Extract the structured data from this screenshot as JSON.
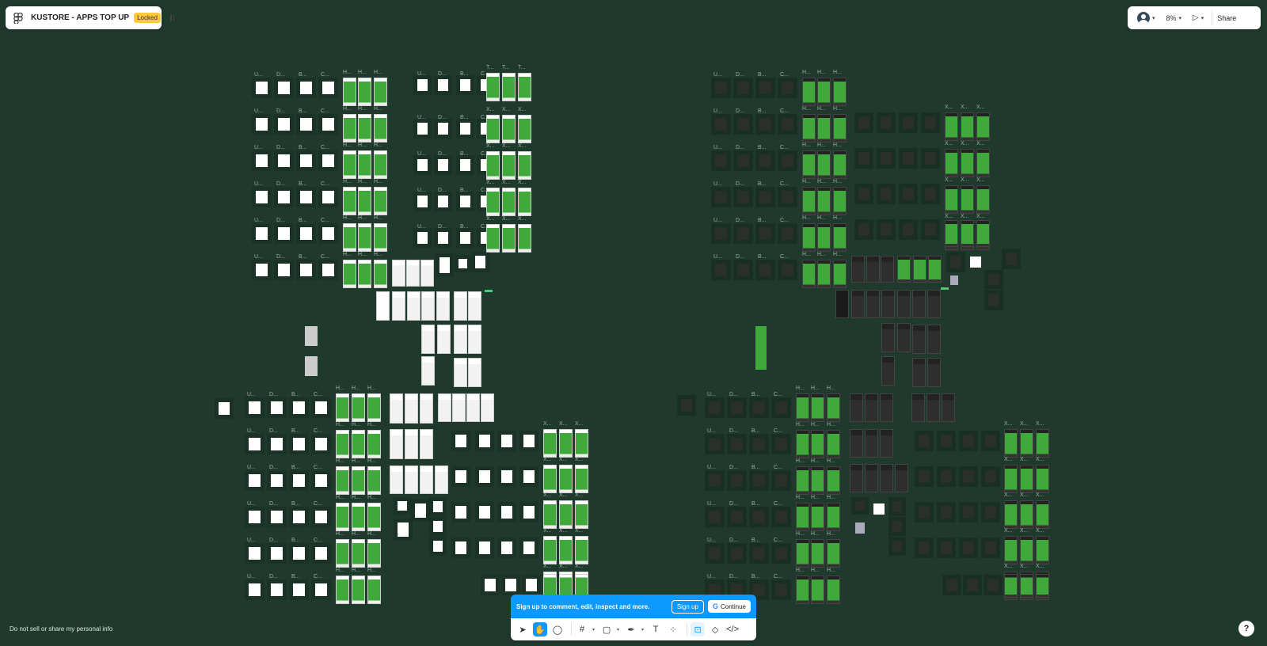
{
  "file": {
    "title": "KUSTORE - APPS TOP UP",
    "status_badge": "Locked"
  },
  "header_right": {
    "zoom": "8%",
    "share_label": "Share"
  },
  "signup_bar": {
    "message": "Sign up to comment, edit, inspect and more.",
    "signup_label": "Sign up",
    "continue_label": "Continue"
  },
  "footer": {
    "privacy_link": "Do not sell or share my personal info",
    "help_label": "?"
  },
  "icons": [
    "figma-logo-icon",
    "sidebar-toggle-icon",
    "avatar",
    "chevron-down-icon",
    "play-icon",
    "move-icon",
    "hand-icon",
    "comment-icon",
    "frame-icon",
    "rectangle-icon",
    "pen-icon",
    "text-icon",
    "components-icon",
    "design-mode-icon",
    "dev-mode-icon",
    "code-icon",
    "help-icon"
  ],
  "canvas": {
    "background_color": "#1f3a2d"
  }
}
